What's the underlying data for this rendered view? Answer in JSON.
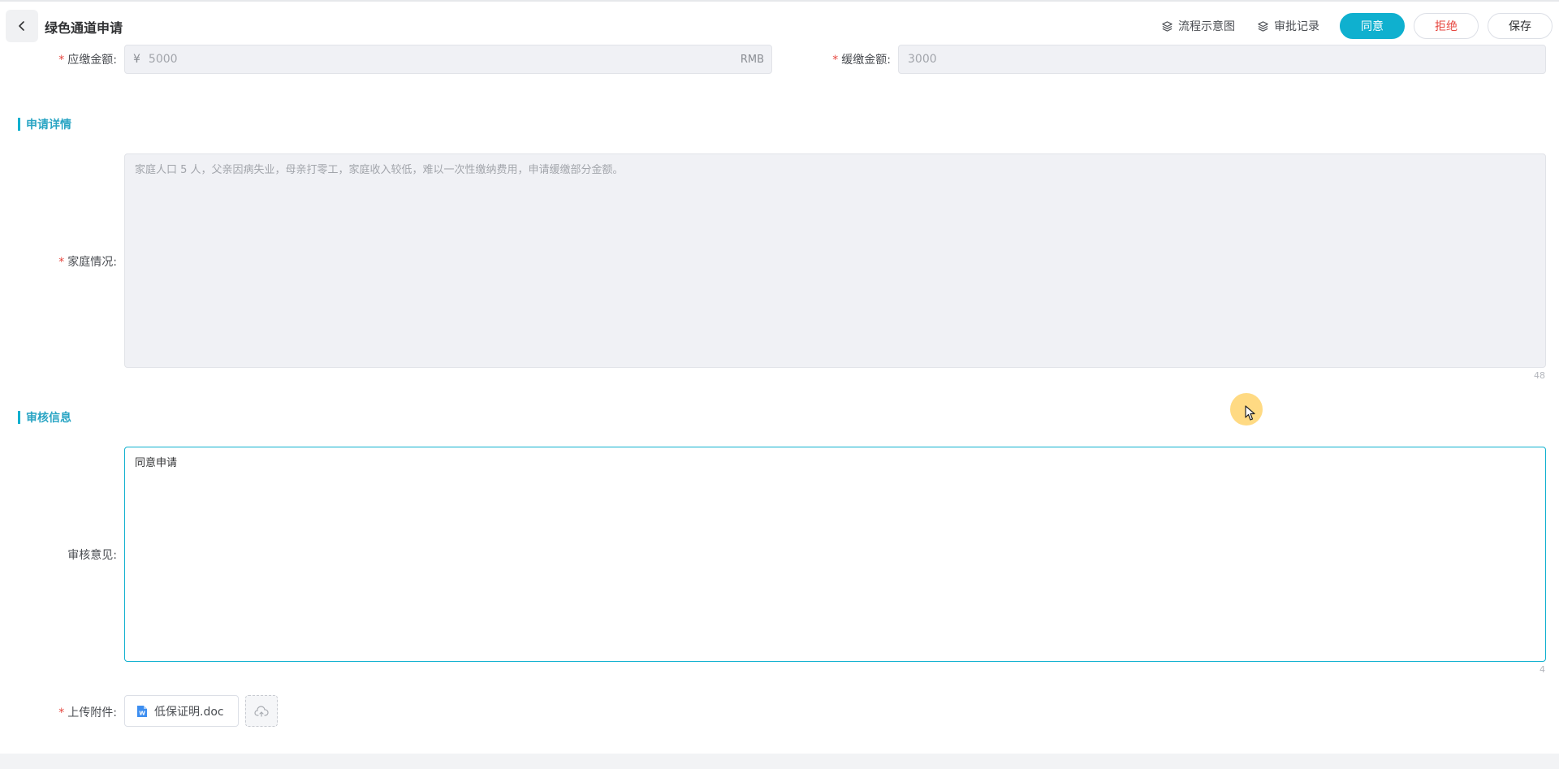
{
  "header": {
    "title": "绿色通道申请",
    "flow_link": "流程示意图",
    "records_link": "审批记录",
    "agree_label": "同意",
    "reject_label": "拒绝",
    "save_label": "保存"
  },
  "amounts": {
    "due_label": "应缴金额:",
    "due_prefix": "¥",
    "due_value": "5000",
    "due_suffix": "RMB",
    "deferred_label": "缓缴金额:",
    "deferred_value": "3000"
  },
  "detail_section": {
    "title": "申请详情",
    "family_label": "家庭情况:",
    "family_value": "家庭人口 5 人，父亲因病失业，母亲打零工，家庭收入较低，难以一次性缴纳费用，申请缓缴部分金额。",
    "family_count": "48"
  },
  "review_section": {
    "title": "审核信息",
    "opinion_label": "审核意见:",
    "opinion_value": "同意申请",
    "opinion_count": "4"
  },
  "attachment": {
    "label": "上传附件:",
    "file_name": "低保证明.doc"
  },
  "colors": {
    "accent": "#0fb0cf",
    "danger": "#e6463f"
  },
  "icons": {
    "back": "chevron-left-icon",
    "flow": "layers-icon",
    "records": "layers-icon",
    "file": "word-doc-icon",
    "upload": "cloud-upload-icon"
  }
}
